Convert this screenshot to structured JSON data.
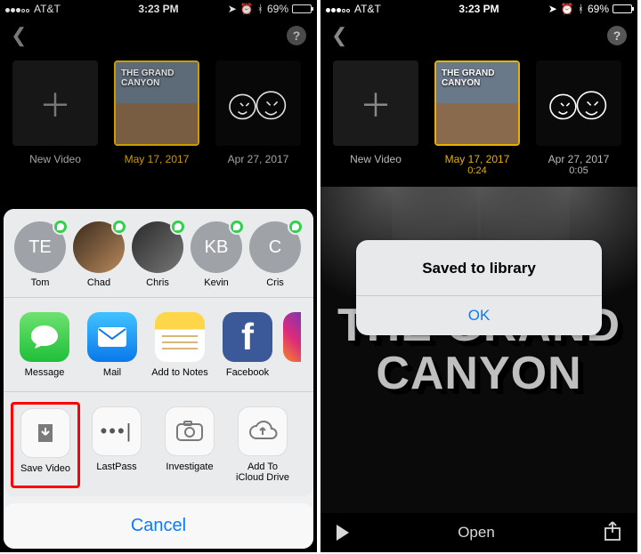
{
  "status": {
    "carrier": "AT&T",
    "time": "3:23 PM",
    "battery_pct": "69%"
  },
  "projects": [
    {
      "label": "New Video",
      "sub": ""
    },
    {
      "label": "May 17, 2017",
      "sub": "0:24",
      "title_overlay": "THE GRAND\nCANYON"
    },
    {
      "label": "Apr 27, 2017",
      "sub": "0:05"
    }
  ],
  "share": {
    "contacts": [
      {
        "name": "Tom",
        "initials": "TE"
      },
      {
        "name": "Chad",
        "initials": ""
      },
      {
        "name": "Chris",
        "initials": ""
      },
      {
        "name": "Kevin",
        "initials": "KB"
      },
      {
        "name": "Cris",
        "initials": "C"
      }
    ],
    "apps": [
      {
        "name": "Message"
      },
      {
        "name": "Mail"
      },
      {
        "name": "Add to Notes"
      },
      {
        "name": "Facebook"
      }
    ],
    "actions": [
      {
        "name": "Save Video"
      },
      {
        "name": "LastPass"
      },
      {
        "name": "Investigate"
      },
      {
        "name": "Add To\niCloud Drive"
      }
    ],
    "cancel": "Cancel"
  },
  "alert": {
    "msg": "Saved to library",
    "ok": "OK"
  },
  "stage_title": "THE GRAND\nCANYON",
  "toolbar": {
    "open": "Open"
  }
}
